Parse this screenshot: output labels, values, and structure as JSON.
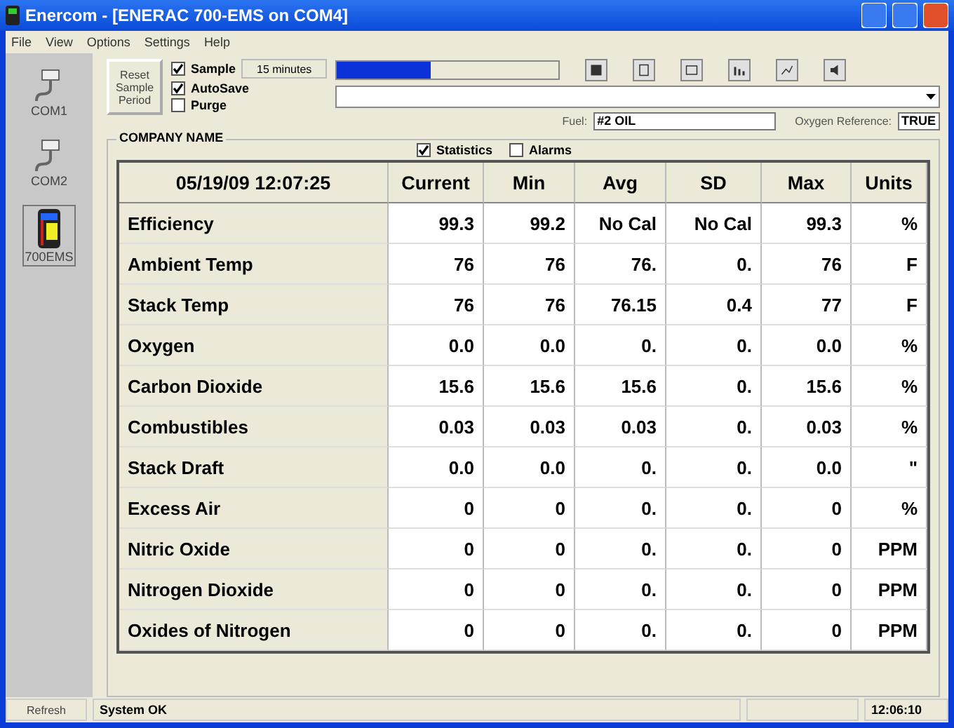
{
  "window": {
    "title": "Enercom - [ENERAC 700-EMS on COM4]"
  },
  "menu": [
    "File",
    "View",
    "Options",
    "Settings",
    "Help"
  ],
  "sidebar": [
    {
      "label": "COM1",
      "kind": "port",
      "selected": false
    },
    {
      "label": "COM2",
      "kind": "port",
      "selected": false
    },
    {
      "label": "700EMS",
      "kind": "device",
      "selected": true
    }
  ],
  "controls": {
    "reset_button": "Reset Sample Period",
    "sample": {
      "label": "Sample",
      "checked": true
    },
    "autosave": {
      "label": "AutoSave",
      "checked": true
    },
    "purge": {
      "label": "Purge",
      "checked": false
    },
    "period_button": "15 minutes",
    "progress": {
      "level": 0.42
    },
    "fuel_label": "Fuel:",
    "fuel_value": "#2 OIL",
    "oxygen_label": "Oxygen Reference:",
    "oxygen_value": "TRUE"
  },
  "toolbar": [
    {
      "kind": "save"
    },
    {
      "kind": "clipboard"
    },
    {
      "kind": "window"
    },
    {
      "kind": "bars"
    },
    {
      "kind": "line"
    },
    {
      "kind": "speaker"
    }
  ],
  "group": {
    "title": "COMPANY NAME",
    "statistics": {
      "label": "Statistics",
      "checked": true
    },
    "alarms": {
      "label": "Alarms",
      "checked": false
    }
  },
  "table": {
    "columns": [
      "05/19/09 12:07:25",
      "Current",
      "Min",
      "Avg",
      "SD",
      "Max",
      "Units"
    ],
    "rows": [
      [
        "Efficiency",
        "99.3",
        "99.2",
        "No Cal",
        "No Cal",
        "99.3",
        "%"
      ],
      [
        "Ambient Temp",
        "76",
        "76",
        "76.",
        "0.",
        "76",
        "F"
      ],
      [
        "Stack Temp",
        "76",
        "76",
        "76.15",
        "0.4",
        "77",
        "F"
      ],
      [
        "Oxygen",
        "0.0",
        "0.0",
        "0.",
        "0.",
        "0.0",
        "%"
      ],
      [
        "Carbon Dioxide",
        "15.6",
        "15.6",
        "15.6",
        "0.",
        "15.6",
        "%"
      ],
      [
        "Combustibles",
        "0.03",
        "0.03",
        "0.03",
        "0.",
        "0.03",
        "%"
      ],
      [
        "Stack Draft",
        "0.0",
        "0.0",
        "0.",
        "0.",
        "0.0",
        "\""
      ],
      [
        "Excess Air",
        "0",
        "0",
        "0.",
        "0.",
        "0",
        "%"
      ],
      [
        "Nitric Oxide",
        "0",
        "0",
        "0.",
        "0.",
        "0",
        "PPM"
      ],
      [
        "Nitrogen Dioxide",
        "0",
        "0",
        "0.",
        "0.",
        "0",
        "PPM"
      ],
      [
        "Oxides of Nitrogen",
        "0",
        "0",
        "0.",
        "0.",
        "0",
        "PPM"
      ]
    ]
  },
  "status_bar": {
    "button": "Refresh",
    "message": "System OK",
    "time": "12:06:10"
  }
}
